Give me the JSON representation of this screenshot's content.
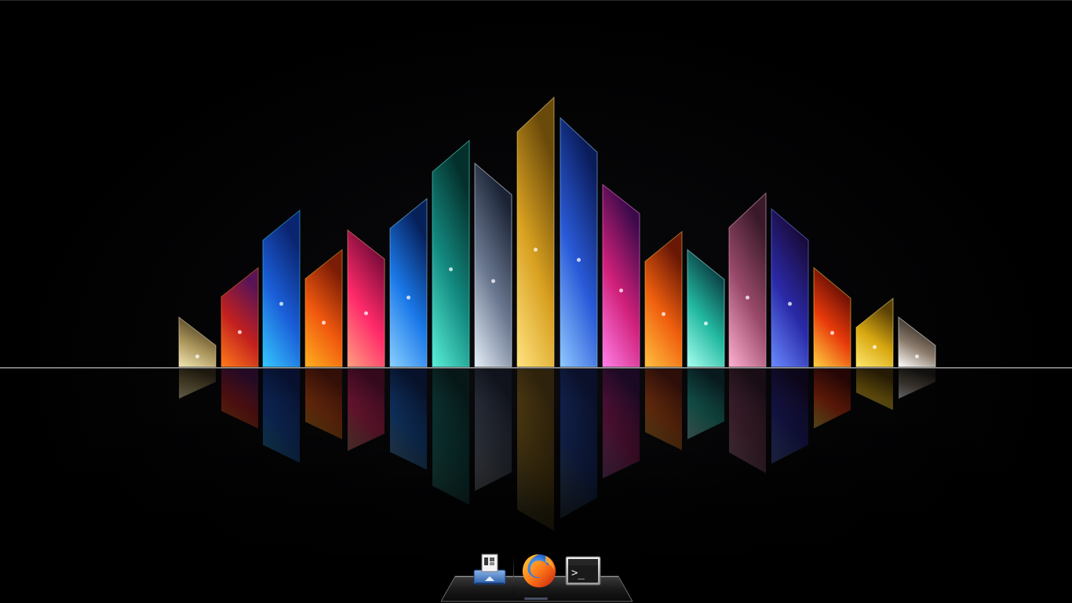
{
  "desktop": {
    "wallpaper": {
      "name": "cosmic-prism-wallpaper",
      "background": "#000000",
      "horizon_color": "#bfbfbf",
      "prisms": [
        {
          "colors": [
            "#f3e6b0",
            "#a8935a",
            "#4a3c20"
          ]
        },
        {
          "colors": [
            "#ff7a1a",
            "#c2201e",
            "#5a1456"
          ]
        },
        {
          "colors": [
            "#35c8ff",
            "#1a5ed8",
            "#0b2470"
          ]
        },
        {
          "colors": [
            "#ffb020",
            "#f0580e",
            "#7a1c06"
          ]
        },
        {
          "colors": [
            "#ffa080",
            "#ff2a6a",
            "#7a0c3a"
          ]
        },
        {
          "colors": [
            "#8ad0ff",
            "#1a78e8",
            "#06205a"
          ]
        },
        {
          "colors": [
            "#5af0d8",
            "#138a80",
            "#04302c"
          ]
        },
        {
          "colors": [
            "#e6eef8",
            "#6a7890",
            "#1a2234"
          ]
        },
        {
          "colors": [
            "#ffe480",
            "#d8a020",
            "#6a4a0a"
          ]
        },
        {
          "colors": [
            "#90c8ff",
            "#2a5ad8",
            "#0a1c5a"
          ]
        },
        {
          "colors": [
            "#ff80e8",
            "#d0207a",
            "#3a0a4a"
          ]
        },
        {
          "colors": [
            "#ffc040",
            "#f0600e",
            "#6a1806"
          ]
        },
        {
          "colors": [
            "#a8fff0",
            "#22b8a0",
            "#0a3a40"
          ]
        },
        {
          "colors": [
            "#ffb0d0",
            "#9a4a6a",
            "#3a1a2a"
          ]
        },
        {
          "colors": [
            "#6a8aff",
            "#2a2aa8",
            "#1a0a3a"
          ]
        },
        {
          "colors": [
            "#ffd040",
            "#e83a0a",
            "#5a0a04"
          ]
        },
        {
          "colors": [
            "#ffe870",
            "#d8a810",
            "#5a4006"
          ]
        },
        {
          "colors": [
            "#ffffff",
            "#8a7a6a",
            "#2a241e"
          ]
        }
      ]
    },
    "dock": {
      "items": [
        {
          "id": "files",
          "icon": "file-manager-icon",
          "label": ""
        },
        {
          "id": "firefox",
          "icon": "firefox-icon",
          "label": ""
        },
        {
          "id": "terminal",
          "icon": "terminal-icon",
          "label": ""
        }
      ],
      "terminal_prompt": ">_"
    }
  }
}
